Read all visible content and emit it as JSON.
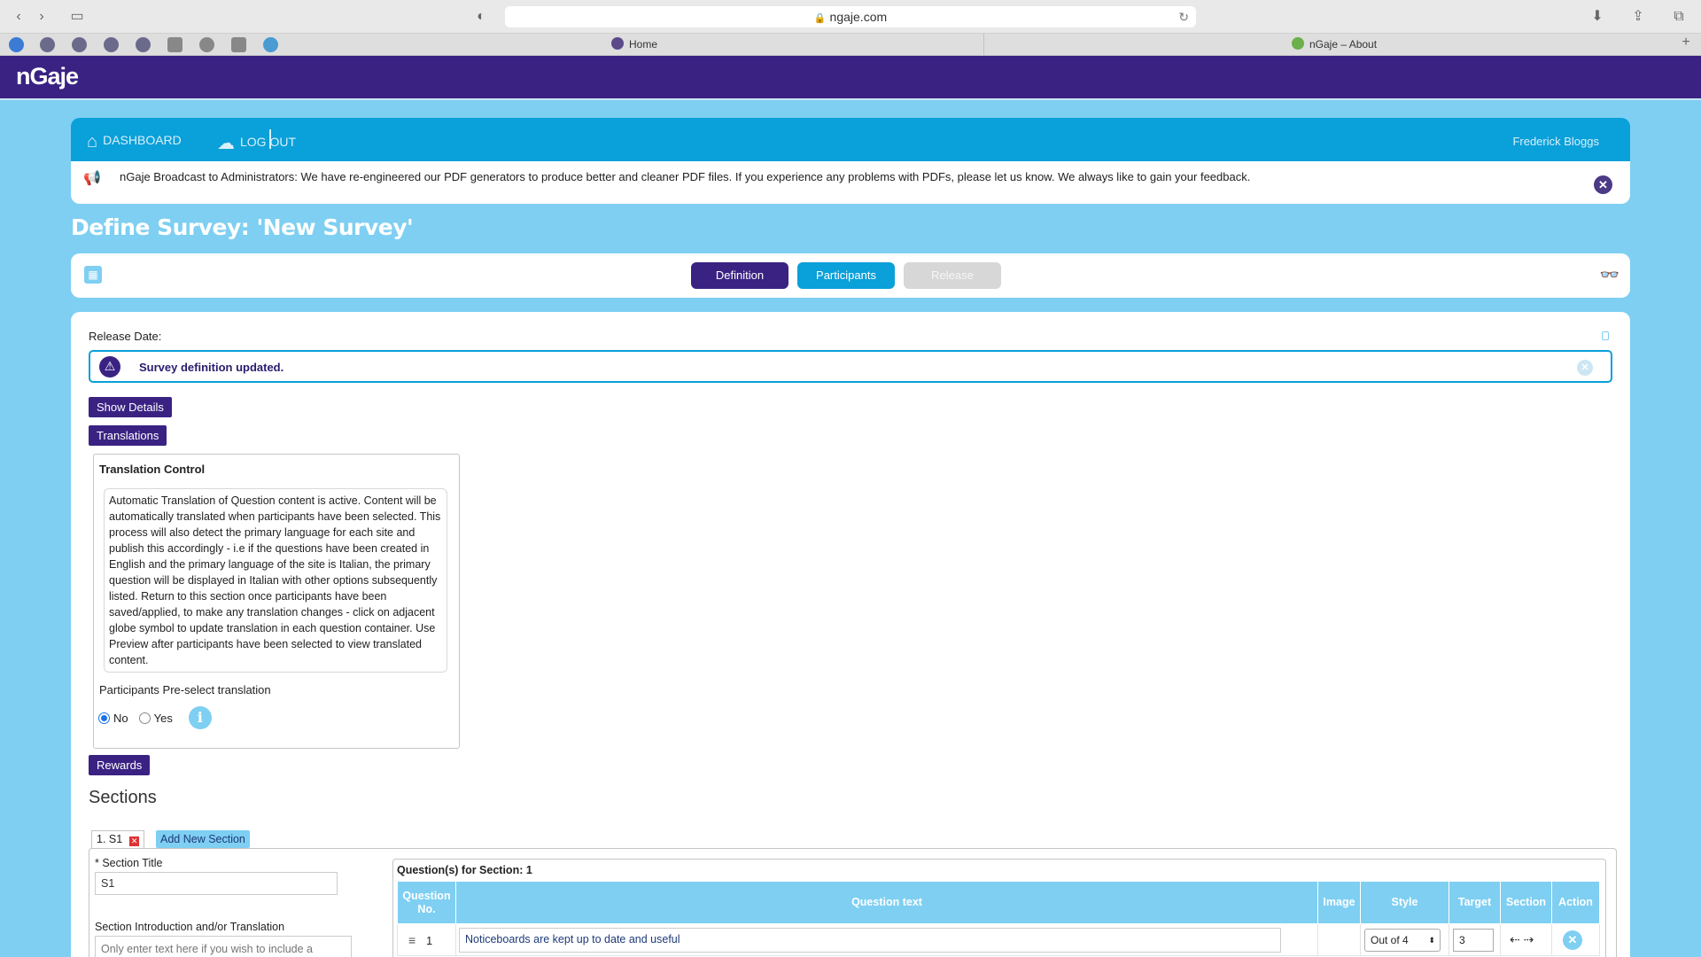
{
  "browser": {
    "url": "ngaje.com",
    "tabs": [
      {
        "title": "Home"
      },
      {
        "title": "nGaje – About"
      }
    ]
  },
  "app": {
    "logo": "nGaje",
    "nav": {
      "dashboard": "DASHBOARD",
      "logout": "LOG OUT",
      "user": "Frederick Bloggs"
    },
    "broadcast": "nGaje Broadcast to Administrators: We have re-engineered our PDF generators to produce better and cleaner PDF files. If you experience any problems with PDFs, please let us know. We always like to gain your feedback."
  },
  "page": {
    "title": "Define Survey: 'New Survey'",
    "tabs": {
      "definition": "Definition",
      "participants": "Participants",
      "release": "Release"
    },
    "release_date_label": "Release Date:",
    "alert": "Survey definition updated.",
    "buttons": {
      "show_details": "Show Details",
      "translations": "Translations",
      "rewards": "Rewards"
    },
    "translation_control": {
      "title": "Translation Control",
      "text": "Automatic Translation of Question content is active. Content will be automatically translated when participants have been selected. This process will also detect the primary language for each site and publish this accordingly - i.e if the questions have been created in English and the primary language of the site is Italian, the primary question will be displayed in Italian with other options subsequently listed. Return to this section once participants have been saved/applied, to make any translation changes - click on adjacent globe symbol to update translation in each question container. Use Preview after participants have been selected to view translated content.",
      "preselect_label": "Participants Pre-select translation",
      "option_no": "No",
      "option_yes": "Yes",
      "selected": "No"
    },
    "sections": {
      "heading": "Sections",
      "tab_label": "1. S1",
      "add_new": "Add New Section",
      "title_label": "* Section Title",
      "title_value": "S1",
      "intro_label": "Section Introduction and/or Translation",
      "intro_placeholder": "Only enter text here if you wish to include a"
    },
    "questions": {
      "heading": "Question(s) for Section: 1",
      "columns": {
        "no": "Question No.",
        "text": "Question text",
        "image": "Image",
        "style": "Style",
        "target": "Target",
        "section": "Section",
        "action": "Action"
      },
      "rows": [
        {
          "no": "1",
          "text": "Noticeboards are kept up to date and useful",
          "style": "Out of 4",
          "target": "3"
        }
      ]
    }
  },
  "colors": {
    "brand_purple": "#3a2283",
    "nav_blue": "#0aa0d9",
    "light_blue": "#7ecff2"
  }
}
